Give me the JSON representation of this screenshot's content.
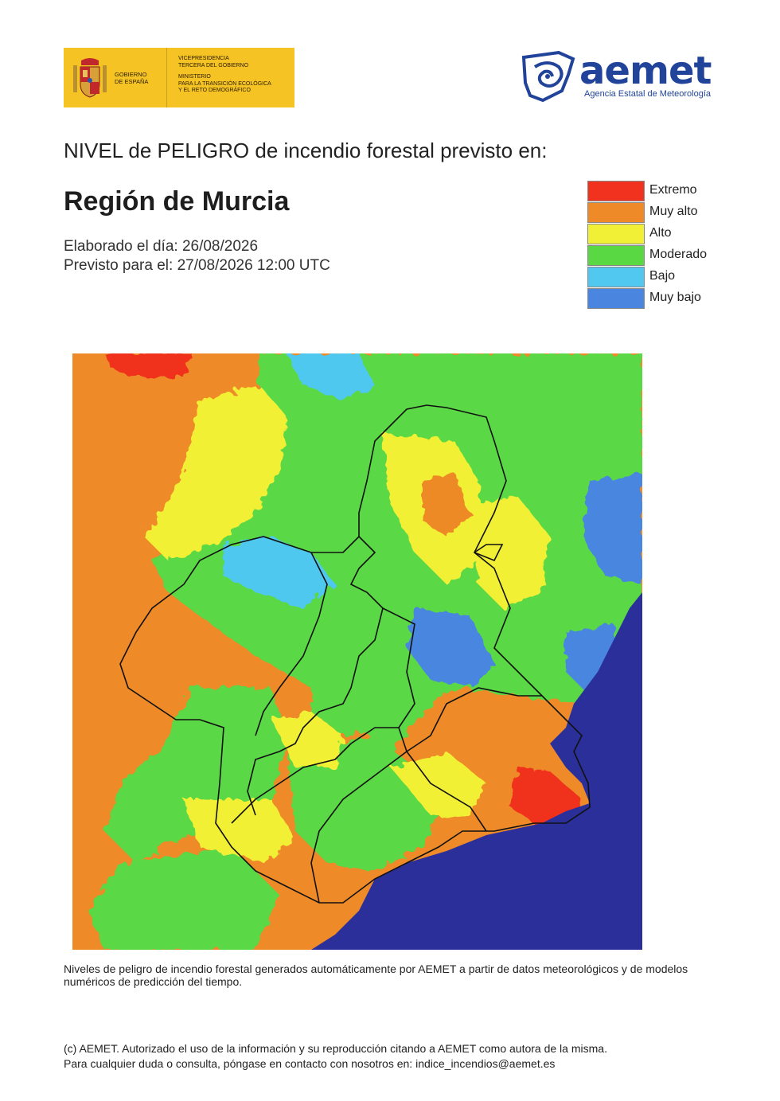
{
  "header": {
    "gov_logo": {
      "name": "GOBIERNO DE ESPAÑA",
      "lines": [
        "VICEPRESIDENCIA",
        "TERCERA DEL GOBIERNO",
        "MINISTERIO",
        "PARA LA TRANSICIÓN ECOLÓGICA",
        "Y EL RETO DEMOGRÁFICO"
      ]
    },
    "aemet_logo": {
      "wordmark": "aemet",
      "subtitle": "Agencia Estatal de Meteorología",
      "brand_color": "#21449a"
    }
  },
  "title": "NIVEL de PELIGRO de incendio forestal previsto en:",
  "region": "Región de Murcia",
  "dates": {
    "elaborated": "Elaborado el día: 26/08/2026",
    "forecast": "Previsto para el: 27/08/2026 12:00 UTC"
  },
  "legend": [
    {
      "label": "Extremo",
      "color": "#f0321e"
    },
    {
      "label": "Muy alto",
      "color": "#ee8a28"
    },
    {
      "label": "Alto",
      "color": "#f2f036"
    },
    {
      "label": "Moderado",
      "color": "#5ad844"
    },
    {
      "label": "Bajo",
      "color": "#50c8f0"
    },
    {
      "label": "Muy bajo",
      "color": "#4a86e0"
    }
  ],
  "map": {
    "sea_color": "#2b2f9a"
  },
  "note": "Niveles de peligro de incendio forestal generados automáticamente por AEMET a partir de datos meteorológicos y de modelos numéricos de predicción del tiempo.",
  "footer": {
    "line1": "(c) AEMET. Autorizado el uso de la información y su reproducción citando a AEMET como autora de la misma.",
    "line2": "Para cualquier duda o consulta, póngase en contacto con nosotros en: indice_incendios@aemet.es"
  }
}
